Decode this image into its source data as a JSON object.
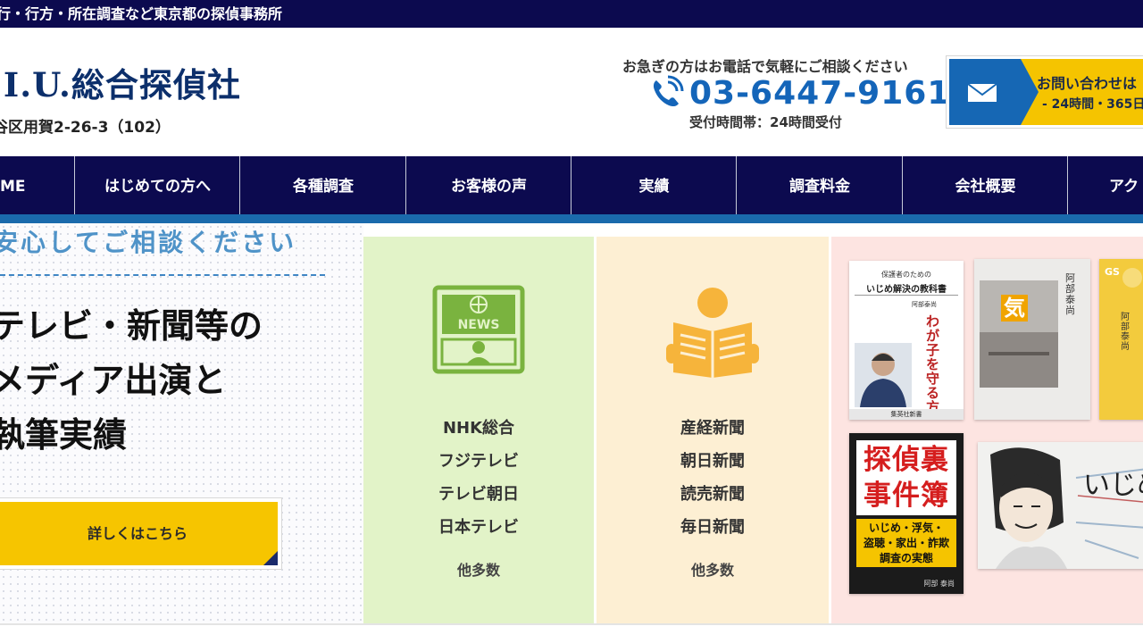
{
  "topbar": {
    "text": "行・行方・所在調査など東京都の探偵事務所"
  },
  "header": {
    "logo": ".I.U.総合探偵社",
    "address": "谷区用賀2-26-3（102）",
    "contact_lead": "お急ぎの方はお電話で気軽にご相談ください",
    "phone": "03-6447-9161",
    "hours": "受付時間帯：24時間受付",
    "inquiry": {
      "line1": "お問い合わせは",
      "line2": "- 24時間・365日"
    }
  },
  "nav": {
    "items": [
      {
        "label": "ME"
      },
      {
        "label": "はじめての方へ"
      },
      {
        "label": "各種調査"
      },
      {
        "label": "お客様の声"
      },
      {
        "label": "実績"
      },
      {
        "label": "調査料金"
      },
      {
        "label": "会社概要"
      },
      {
        "label": "アク"
      }
    ]
  },
  "main": {
    "tagline": "安心してご相談ください",
    "heading_lines": [
      "テレビ・新聞等の",
      "メディア出演と",
      "執筆実績"
    ],
    "details_button": "詳しくはこちら",
    "tv": {
      "icon_text": "NEWS",
      "items": [
        "NHK総合",
        "フジテレビ",
        "テレビ朝日",
        "日本テレビ"
      ],
      "more": "他多数"
    },
    "newspaper": {
      "items": [
        "産経新聞",
        "朝日新聞",
        "読売新聞",
        "毎日新聞"
      ],
      "more": "他多数"
    },
    "books": {
      "book1": {
        "subtitle": "保護者のための",
        "title": "いじめ解決の教科書",
        "author": "阿部泰尚",
        "main": "わが子を守る方法",
        "publisher": "集英社新書"
      },
      "book2": {
        "cover": "気",
        "author": "阿部泰尚"
      },
      "book3": {
        "mark": "GS",
        "author": "阿部泰尚"
      },
      "book4": {
        "title_top": "探偵裏",
        "title_bottom": "事件簿",
        "topic1": "いじめ・浮気・",
        "topic2": "盗聴・家出・詐欺",
        "topic3": "調査の実態",
        "author": "阿部 泰尚"
      },
      "book5": {
        "title": "いじめ"
      }
    }
  },
  "colors": {
    "navy": "#0c0a4f",
    "accent_blue": "#1a6aac",
    "yellow": "#f6c500",
    "tv_bg": "#e2f3c8",
    "paper_bg": "#fdefd3",
    "books_bg": "#fde4e1"
  }
}
